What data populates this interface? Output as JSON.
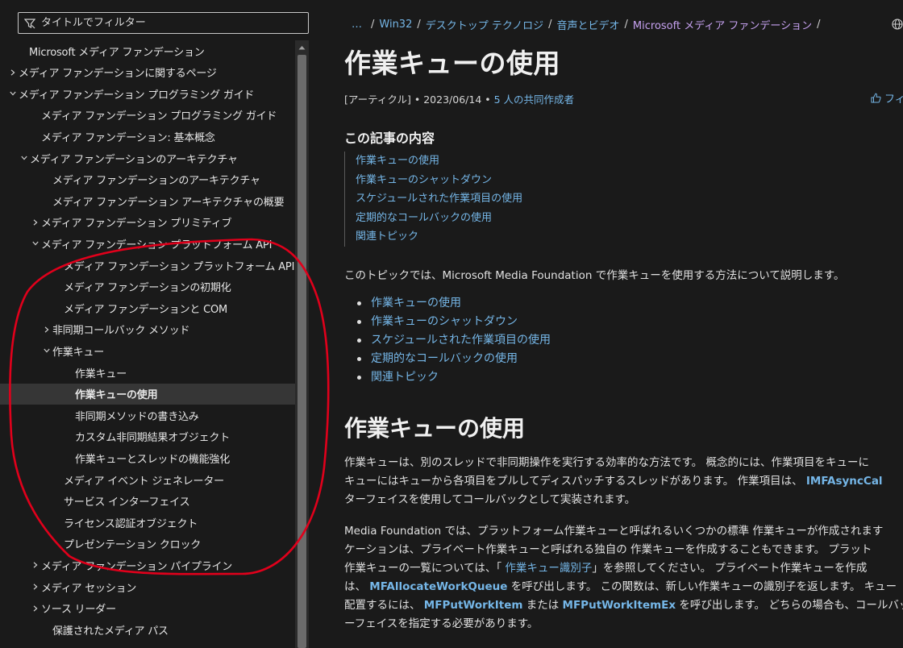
{
  "sidebar": {
    "filter_placeholder": "タイトルでフィルター",
    "items": [
      {
        "label": "Microsoft メディア ファンデーション",
        "chevron": ""
      },
      {
        "label": "メディア ファンデーションに関するページ",
        "chevron": "right"
      },
      {
        "label": "メディア ファンデーション プログラミング ガイド",
        "chevron": "down"
      },
      {
        "label": "メディア ファンデーション プログラミング ガイド",
        "chevron": ""
      },
      {
        "label": "メディア ファンデーション: 基本概念",
        "chevron": ""
      },
      {
        "label": "メディア ファンデーションのアーキテクチャ",
        "chevron": "down"
      },
      {
        "label": "メディア ファンデーションのアーキテクチャ",
        "chevron": ""
      },
      {
        "label": "メディア ファンデーション アーキテクチャの概要",
        "chevron": ""
      },
      {
        "label": "メディア ファンデーション プリミティブ",
        "chevron": "right"
      },
      {
        "label": "メディア ファンデーション プラットフォーム API",
        "chevron": "down"
      },
      {
        "label": "メディア ファンデーション プラットフォーム API",
        "chevron": ""
      },
      {
        "label": "メディア ファンデーションの初期化",
        "chevron": ""
      },
      {
        "label": "メディア ファンデーションと COM",
        "chevron": ""
      },
      {
        "label": "非同期コールバック メソッド",
        "chevron": "right"
      },
      {
        "label": "作業キュー",
        "chevron": "down"
      },
      {
        "label": "作業キュー",
        "chevron": ""
      },
      {
        "label": "作業キューの使用",
        "chevron": "",
        "selected": true
      },
      {
        "label": "非同期メソッドの書き込み",
        "chevron": ""
      },
      {
        "label": "カスタム非同期結果オブジェクト",
        "chevron": ""
      },
      {
        "label": "作業キューとスレッドの機能強化",
        "chevron": ""
      },
      {
        "label": "メディア イベント ジェネレーター",
        "chevron": ""
      },
      {
        "label": "サービス インターフェイス",
        "chevron": ""
      },
      {
        "label": "ライセンス認証オブジェクト",
        "chevron": ""
      },
      {
        "label": "プレゼンテーション クロック",
        "chevron": ""
      },
      {
        "label": "メディア ファンデーション パイプライン",
        "chevron": "right"
      },
      {
        "label": "メディア セッション",
        "chevron": "right"
      },
      {
        "label": "ソース リーダー",
        "chevron": "right"
      },
      {
        "label": "保護されたメディア パス",
        "chevron": ""
      }
    ]
  },
  "breadcrumb": {
    "dots": "…",
    "items": [
      "Win32",
      "デスクトップ テクノロジ",
      "音声とビデオ",
      "Microsoft メディア ファンデーション"
    ]
  },
  "article": {
    "title": "作業キューの使用",
    "type": "[アーティクル]",
    "date": "2023/06/14",
    "contributors": "5 人の共同作成者",
    "feedback": "フィ",
    "in_this_article": "この記事の内容",
    "toc_links": [
      "作業キューの使用",
      "作業キューのシャットダウン",
      "スケジュールされた作業項目の使用",
      "定期的なコールバックの使用",
      "関連トピック"
    ],
    "intro": "このトピックでは、Microsoft Media Foundation で作業キューを使用する方法について説明します。",
    "bullets": [
      "作業キューの使用",
      "作業キューのシャットダウン",
      "スケジュールされた作業項目の使用",
      "定期的なコールバックの使用",
      "関連トピック"
    ],
    "section_title": "作業キューの使用",
    "p1": {
      "l1": "作業キューは、別のスレッドで非同期操作を実行する効率的な方法です。 概念的には、作業項目をキューに",
      "l2a": "キューにはキューから各項目をプルしてディスパッチするスレッドがあります。 作業項目は、 ",
      "l2b": "IMFAsyncCal",
      "l3": "ターフェイスを使用してコールバックとして実装されます。"
    },
    "p2": {
      "l1": "Media Foundation では、プラットフォーム作業キューと呼ばれるいくつかの標準 作業キューが作成されます",
      "l2": "ケーションは、プライベート作業キューと呼ばれる独自の 作業キューを作成することもできます。 プラット",
      "l3a": "作業キューの一覧については、「 ",
      "l3b": "作業キュー識別子",
      "l3c": "」を参照してください。 プライベート作業キューを作成",
      "l4a": "は、 ",
      "l4b": "MFAllocateWorkQueue",
      "l4c": " を呼び出します。 この関数は、新しい作業キューの識別子を返します。 キュー",
      "l5a": "配置するには、 ",
      "l5b": "MFPutWorkItem",
      "l5c": " または ",
      "l5d": "MFPutWorkItemEx",
      "l5e": " を呼び出します。 どちらの場合も、コールバッ",
      "l6": "ーフェイスを指定する必要があります。"
    }
  },
  "colors": {
    "background": "#1a1a1a",
    "link": "#75b6e7",
    "breadcrumb_current": "#c6a1f0",
    "annotation": "#e0001b",
    "selected_row": "#363636"
  }
}
